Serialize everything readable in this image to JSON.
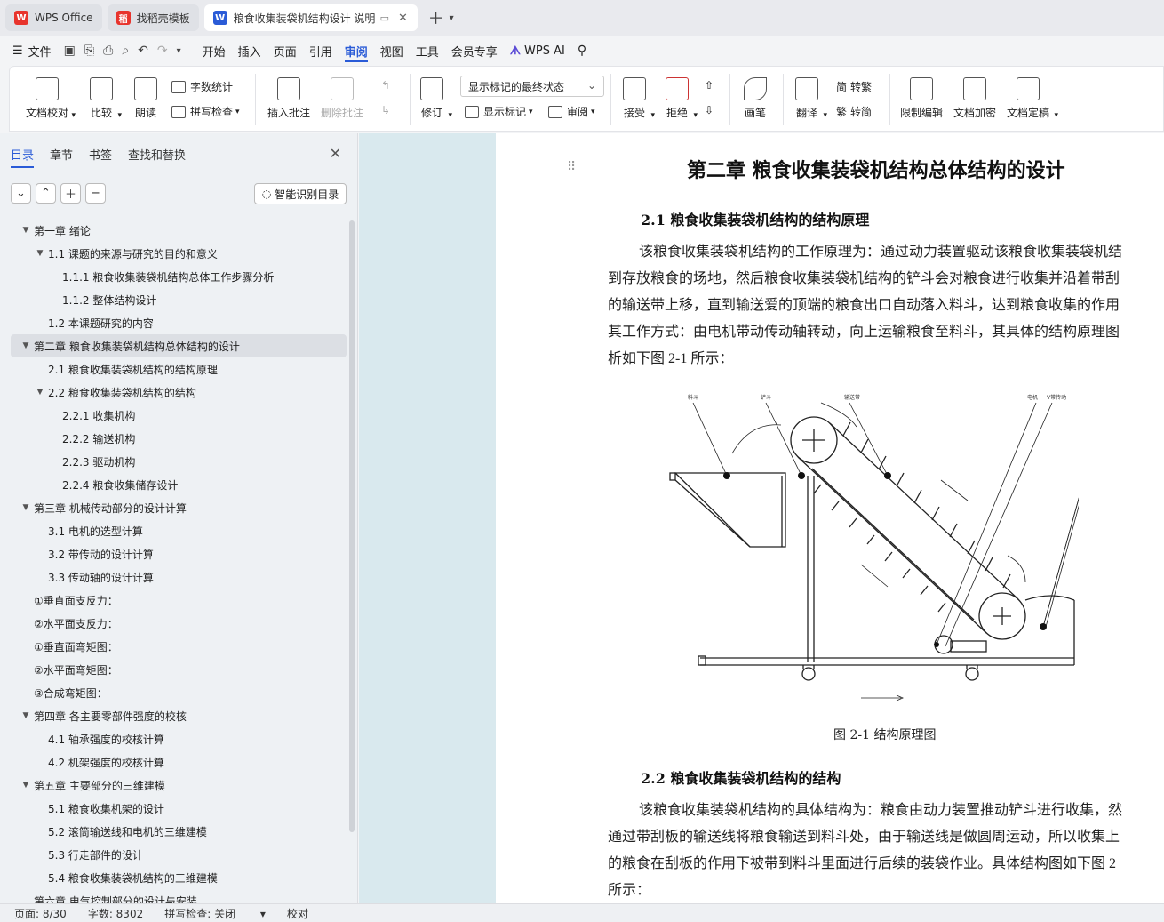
{
  "tabs": [
    {
      "label": "WPS Office",
      "icon": "wps-logo-icon",
      "color": "#e8342d"
    },
    {
      "label": "找稻壳模板",
      "icon": "docer-icon",
      "color": "#e8342d"
    },
    {
      "label": "粮食收集装袋机结构设计 说明",
      "icon": "writer-icon",
      "color": "#2a5bd7"
    }
  ],
  "menu": {
    "file": "文件",
    "items": [
      "开始",
      "插入",
      "页面",
      "引用",
      "审阅",
      "视图",
      "工具",
      "会员专享"
    ],
    "active": "审阅",
    "ai": "WPS AI"
  },
  "ribbon": {
    "doc_check": "文档校对",
    "compare": "比较",
    "read": "朗读",
    "word_count": "字数统计",
    "spell_check": "拼写检查",
    "insert_comment": "插入批注",
    "delete_comment": "删除批注",
    "revise": "修订",
    "markup_state": "显示标记的最终状态",
    "show_markup": "显示标记",
    "review": "审阅",
    "accept": "接受",
    "reject": "拒绝",
    "pen": "画笔",
    "translate": "翻译",
    "to_traditional": "转繁",
    "to_simplified": "转简",
    "restrict_edit": "限制编辑",
    "encrypt": "文档加密",
    "finalize": "文档定稿"
  },
  "panel": {
    "tabs": [
      "目录",
      "章节",
      "书签",
      "查找和替换"
    ],
    "active": "目录",
    "smart_toc": "智能识别目录",
    "toc": [
      {
        "text": "第一章  绪论",
        "level": 0,
        "toggle": "open"
      },
      {
        "text": "1.1  课题的来源与研究的目的和意义",
        "level": 1,
        "toggle": "open"
      },
      {
        "text": "1.1.1  粮食收集装袋机结构总体工作步骤分析",
        "level": 2
      },
      {
        "text": "1.1.2  整体结构设计",
        "level": 2
      },
      {
        "text": "1.2  本课题研究的内容",
        "level": 1
      },
      {
        "text": "第二章  粮食收集装袋机结构总体结构的设计",
        "level": 0,
        "toggle": "open",
        "selected": true
      },
      {
        "text": "2.1  粮食收集装袋机结构的结构原理",
        "level": 1
      },
      {
        "text": "2.2  粮食收集装袋机结构的结构",
        "level": 1,
        "toggle": "open"
      },
      {
        "text": "2.2.1    收集机构",
        "level": 2
      },
      {
        "text": "2.2.2    输送机构",
        "level": 2
      },
      {
        "text": "2.2.3  驱动机构",
        "level": 2
      },
      {
        "text": "2.2.4  粮食收集储存设计",
        "level": 2
      },
      {
        "text": "第三章  机械传动部分的设计计算",
        "level": 0,
        "toggle": "open"
      },
      {
        "text": "3.1  电机的选型计算",
        "level": 1
      },
      {
        "text": "3.2  带传动的设计计算",
        "level": 1
      },
      {
        "text": "3.3  传动轴的设计计算",
        "level": 1
      },
      {
        "text": "①垂直面支反力：",
        "level": 0
      },
      {
        "text": "②水平面支反力：",
        "level": 0
      },
      {
        "text": "①垂直面弯矩图：",
        "level": 0
      },
      {
        "text": "②水平面弯矩图：",
        "level": 0
      },
      {
        "text": "③合成弯矩图：",
        "level": 0
      },
      {
        "text": "第四章  各主要零部件强度的校核",
        "level": 0,
        "toggle": "open"
      },
      {
        "text": "4.1  轴承强度的校核计算",
        "level": 1
      },
      {
        "text": "4.2  机架强度的校核计算",
        "level": 1
      },
      {
        "text": "第五章  主要部分的三维建模",
        "level": 0,
        "toggle": "open"
      },
      {
        "text": "5.1  粮食收集机架的设计",
        "level": 1
      },
      {
        "text": "5.2  滚筒输送线和电机的三维建模",
        "level": 1
      },
      {
        "text": "5.3  行走部件的设计",
        "level": 1
      },
      {
        "text": "5.4  粮食收集装袋机结构的三维建模",
        "level": 1
      },
      {
        "text": "第六章  电气控制部分的设计与安装",
        "level": 0
      }
    ]
  },
  "doc": {
    "chapter": "第二章  粮食收集装袋机结构总体结构的设计",
    "s21": "2.1   粮食收集装袋机结构的结构原理",
    "p1": [
      "该粮食收集装袋机结构的工作原理为：通过动力装置驱动该粮食收集装袋机结",
      "到存放粮食的场地，然后粮食收集装袋机结构的铲斗会对粮食进行收集并沿着带刮",
      "的输送带上移，直到输送爱的顶端的粮食出口自动落入料斗，达到粮食收集的作用",
      "其工作方式：由电机带动传动轴转动，向上运输粮食至料斗，其具体的结构原理图",
      "析如下图 2-1 所示："
    ],
    "caption": "图 2-1   结构原理图",
    "s22": "2.2   粮食收集装袋机结构的结构",
    "p2": [
      "该粮食收集装袋机结构的具体结构为：粮食由动力装置推动铲斗进行收集，然",
      "通过带刮板的输送线将粮食输送到料斗处，由于输送线是做圆周运动，所以收集上",
      "的粮食在刮板的作用下被带到料斗里面进行后续的装袋作业。具体结构图如下图 2",
      "所示："
    ]
  },
  "status": {
    "page": "页面: 8/30",
    "words": "字数: 8302",
    "spell": "拼写检查: 关闭",
    "proof": "校对"
  }
}
